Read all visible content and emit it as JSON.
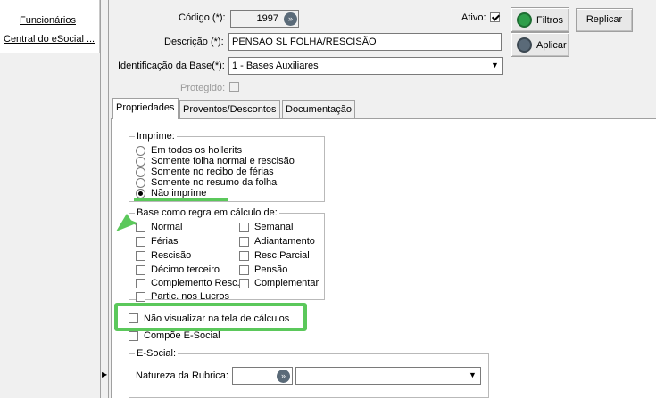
{
  "left_nav": {
    "items": [
      {
        "label": "Funcionários"
      },
      {
        "label": "Central do eSocial ..."
      }
    ]
  },
  "form": {
    "codigo": {
      "label": "Código (*):",
      "value": "1997"
    },
    "descricao": {
      "label": "Descrição (*):",
      "value": "PENSAO SL FOLHA/RESCISÃO"
    },
    "identificacao": {
      "label": "Identificação da Base(*):",
      "value": "1 - Bases Auxiliares"
    },
    "protegido": {
      "label": "Protegido:",
      "checked": false
    },
    "ativo": {
      "label": "Ativo:",
      "checked": true
    }
  },
  "buttons": {
    "filtros": "Filtros",
    "aplicar": "Aplicar",
    "replicar": "Replicar"
  },
  "tabs": [
    {
      "label": "Propriedades",
      "active": true
    },
    {
      "label": "Proventos/Descontos",
      "active": false
    },
    {
      "label": "Documentação",
      "active": false
    }
  ],
  "imprime": {
    "title": "Imprime:",
    "options": [
      {
        "label": "Em todos os hollerits",
        "selected": false
      },
      {
        "label": "Somente folha normal e rescisão",
        "selected": false
      },
      {
        "label": "Somente no recibo de férias",
        "selected": false
      },
      {
        "label": "Somente no resumo da folha",
        "selected": false
      },
      {
        "label": "Não imprime",
        "selected": true
      }
    ]
  },
  "base_regra": {
    "title": "Base como regra em cálculo de:",
    "left": [
      {
        "label": "Normal",
        "checked": false
      },
      {
        "label": "Férias",
        "checked": false
      },
      {
        "label": "Rescisão",
        "checked": false
      },
      {
        "label": "Décimo terceiro",
        "checked": false
      },
      {
        "label": "Complemento Resc.",
        "checked": false
      },
      {
        "label": "Partic. nos Lucros",
        "checked": false
      }
    ],
    "right": [
      {
        "label": "Semanal",
        "checked": false
      },
      {
        "label": "Adiantamento",
        "checked": false
      },
      {
        "label": "Resc.Parcial",
        "checked": false
      },
      {
        "label": "Pensão",
        "checked": false
      },
      {
        "label": "Complementar",
        "checked": false
      }
    ]
  },
  "nao_visualizar": {
    "label": "Não visualizar na tela de cálculos",
    "checked": false
  },
  "compoe_esocial": {
    "label": "Compõe E-Social",
    "checked": false
  },
  "esocial": {
    "title": "E-Social:",
    "natureza_label": "Natureza da Rubrica:",
    "natureza_code": "",
    "natureza_desc": ""
  },
  "colors": {
    "highlight": "#5bc85b",
    "filtros_icon": "#2e9e4a",
    "aplicar_icon": "#5a6a78"
  }
}
